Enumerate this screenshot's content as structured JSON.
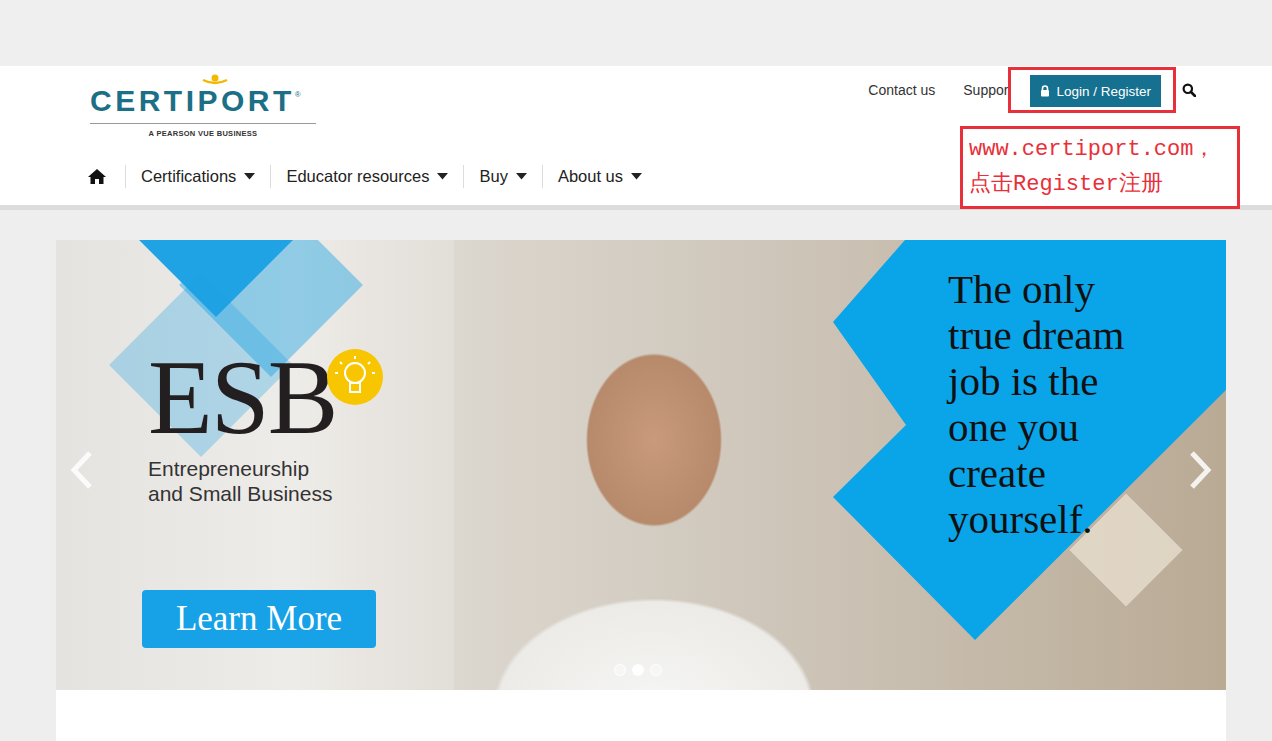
{
  "header": {
    "logo": {
      "name": "CERTIPORT",
      "registered": "®",
      "tagline": "A PEARSON VUE BUSINESS"
    },
    "top_links": [
      "Contact us",
      "Suppor"
    ],
    "login_button": "Login / Register"
  },
  "annotation": {
    "lines": [
      "www.certiport.com，",
      "点击Register注册"
    ]
  },
  "nav": [
    {
      "label": "Certifications",
      "dropdown": true
    },
    {
      "label": "Educator resources",
      "dropdown": true
    },
    {
      "label": "Buy",
      "dropdown": true
    },
    {
      "label": "About us",
      "dropdown": true
    }
  ],
  "carousel": {
    "logo": "ESB",
    "subtitle_lines": [
      "Entrepreneurship",
      "and Small Business"
    ],
    "button": "Learn More",
    "quote_lines": [
      "The only",
      "true dream",
      "job is the",
      "one you",
      "create",
      "yourself."
    ],
    "dots": [
      {
        "selected": false
      },
      {
        "selected": true
      },
      {
        "selected": false
      }
    ]
  }
}
